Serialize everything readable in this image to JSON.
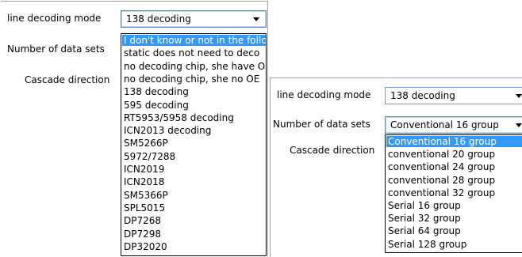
{
  "left_panel": {
    "labels": {
      "line_decoding_mode": "line decoding mode",
      "number_of_data_sets": "Number of data sets",
      "cascade_direction": "Cascade direction"
    },
    "combo": {
      "value": "138 decoding"
    },
    "dropdown": {
      "options": [
        "I don't know or not in the follo",
        "static does not need to deco",
        "no decoding chip, she have O",
        "no decoding chip, she no OE",
        "138 decoding",
        "595 decoding",
        "RT5953/5958 decoding",
        "ICN2013 decoding",
        "SM5266P",
        "5972/7288",
        "ICN2019",
        "ICN2018",
        "SM5366P",
        "SPL5015",
        "DP7268",
        "DP7298",
        "DP32020"
      ],
      "highlighted_index": 0
    }
  },
  "right_panel": {
    "labels": {
      "line_decoding_mode": "line decoding mode",
      "number_of_data_sets": "Number of data sets",
      "cascade_direction": "Cascade direction"
    },
    "decoding_combo": {
      "value": "138 decoding"
    },
    "data_sets_combo": {
      "value": "Conventional 16 group"
    },
    "dropdown": {
      "options": [
        "Conventional 16 group",
        "conventional 20 group",
        "conventional 24 group",
        "conventional 28 group",
        "conventional 32 group",
        "Serial 16 group",
        "Serial 32 group",
        "Serial 64 group",
        "Serial 128 group"
      ],
      "highlighted_index": 0
    }
  },
  "colors": {
    "highlight": "#3399ff",
    "combo_border": "#7a9cc6"
  }
}
